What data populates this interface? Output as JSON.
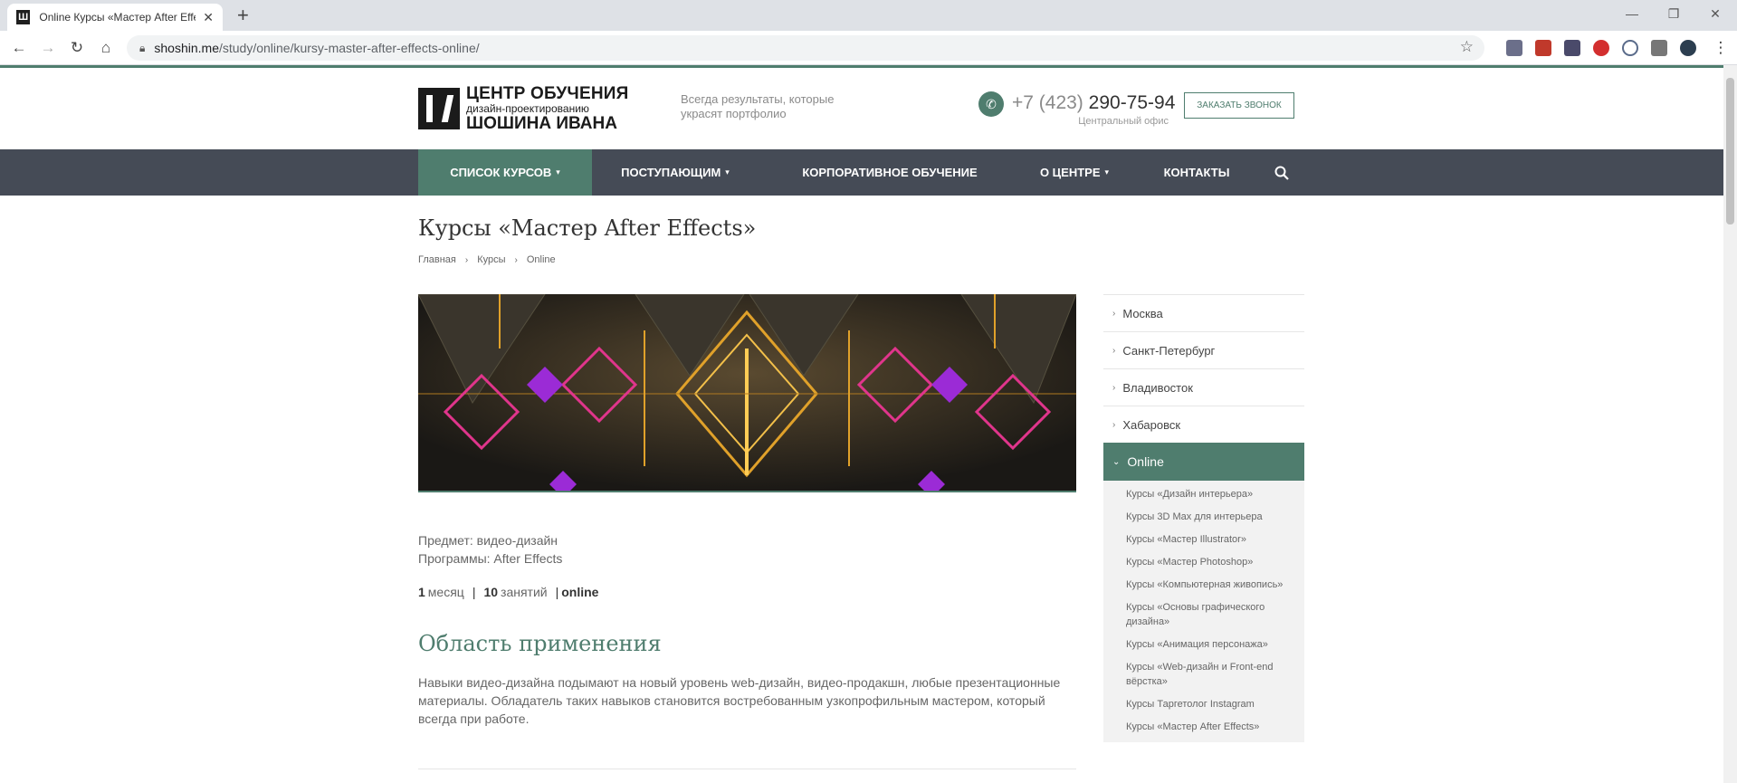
{
  "browser": {
    "tab_title": "Online Курсы «Мастер After Effe",
    "favicon_letter": "Ш",
    "new_tab": "+",
    "url_host": "shoshin.me",
    "url_path": "/study/online/kursy-master-after-effects-online/",
    "window_controls": [
      "—",
      "❐",
      "✕"
    ]
  },
  "header": {
    "logo_line1": "ЦЕНТР ОБУЧЕНИЯ",
    "logo_line2": "дизайн-проектированию",
    "logo_line3": "ШОШИНА ИВАНА",
    "tagline": "Всегда результаты, которые украсят портфолио",
    "phone_code": "+7 (423)",
    "phone_number": "290-75-94",
    "office": "Центральный офис",
    "call_button": "ЗАКАЗАТЬ ЗВОНОК"
  },
  "nav": {
    "items": [
      {
        "label": "СПИСОК КУРСОВ",
        "caret": "▾"
      },
      {
        "label": "ПОСТУПАЮЩИМ",
        "caret": "▾"
      },
      {
        "label": "КОРПОРАТИВНОЕ ОБУЧЕНИЕ",
        "caret": ""
      },
      {
        "label": "О ЦЕНТРЕ",
        "caret": "▾"
      },
      {
        "label": "КОНТАКТЫ",
        "caret": ""
      }
    ]
  },
  "page": {
    "title": "Курсы «Мастер After Effects»",
    "breadcrumbs": [
      "Главная",
      "Курсы",
      "Online"
    ],
    "subject": "Предмет: видео-дизайн",
    "programs": "Программы: After Effects",
    "duration_num": "1",
    "duration_unit": "месяц",
    "lessons_num": "10",
    "lessons_unit": "занятий",
    "format": "online",
    "section_title": "Область применения",
    "section_text": "Навыки видео-дизайна подымают на новый уровень web-дизайн, видео-продакшн, любые презентационные материалы. Обладатель таких навыков становится востребованным узкопрофильным мастером, который всегда при работе."
  },
  "sidebar": {
    "cities": [
      "Москва",
      "Санкт-Петербург",
      "Владивосток",
      "Хабаровск"
    ],
    "active": "Online",
    "courses": [
      "Курсы «Дизайн интерьера»",
      "Курсы 3D Max для интерьера",
      "Курсы «Мастер Illustrator»",
      "Курсы «Мастер Photoshop»",
      "Курсы «Компьютерная живопись»",
      "Курсы «Основы графического дизайна»",
      "Курсы «Анимация персонажа»",
      "Курсы «Web-дизайн и Front-end вёрстка»",
      "Курсы Таргетолог Instagram",
      "Курсы «Мастер After Effects»"
    ]
  },
  "colors": {
    "accent": "#4f7d6e",
    "nav_bg": "#454b56"
  }
}
